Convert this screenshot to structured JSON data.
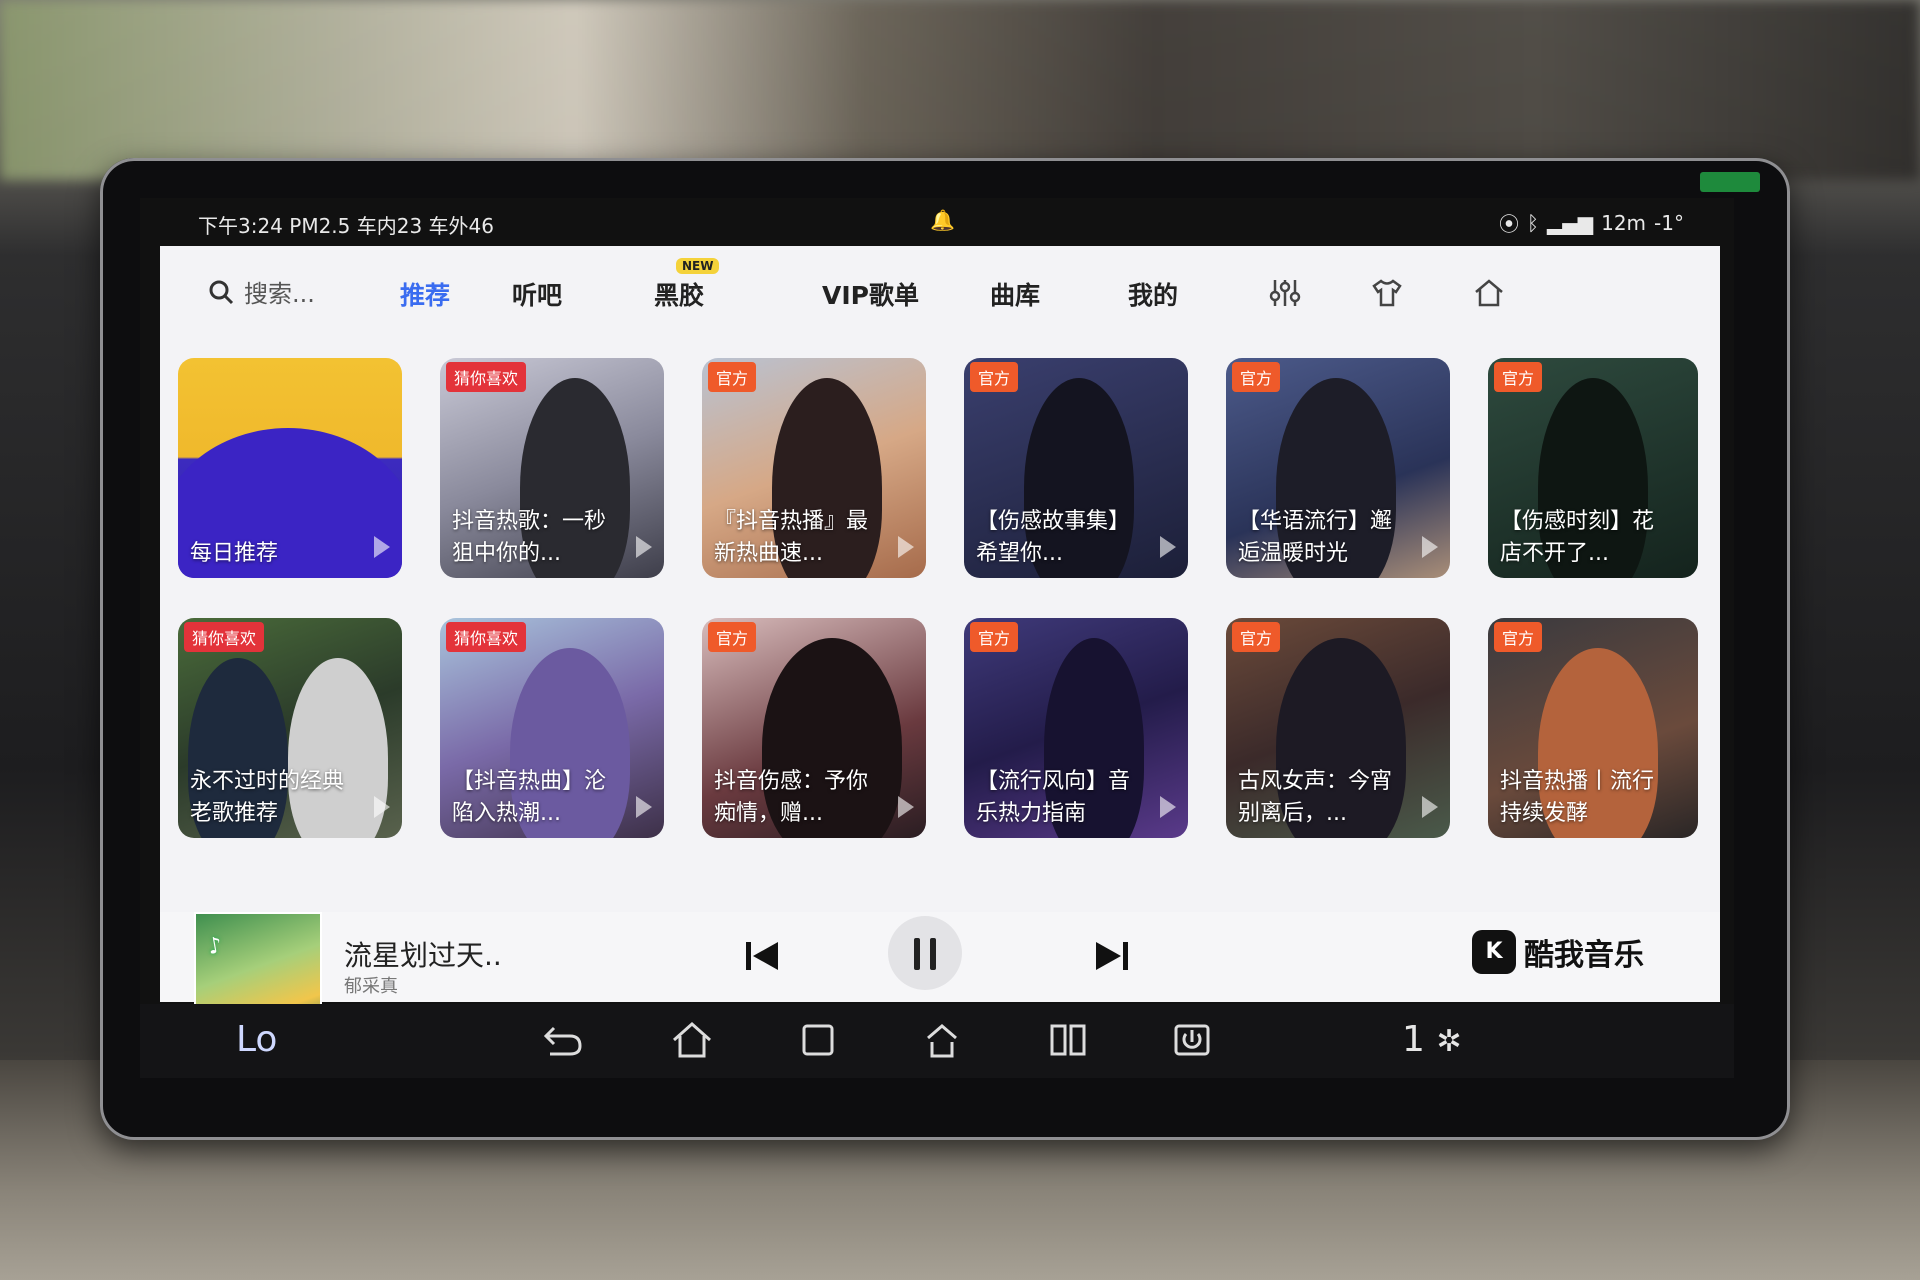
{
  "statusbar": {
    "left": "下午3:24 PM2.5 车内23 车外46",
    "center_icon": "bell-icon",
    "right": "12m",
    "temp": "-1°"
  },
  "nav": {
    "search_placeholder": "搜索...",
    "tabs": [
      {
        "label": "推荐",
        "active": true
      },
      {
        "label": "听吧"
      },
      {
        "label": "黑胶",
        "badge": "NEW"
      },
      {
        "label": "VIP歌单"
      },
      {
        "label": "曲库"
      },
      {
        "label": "我的"
      }
    ],
    "icons": [
      "equalizer-icon",
      "shirt-icon",
      "home-icon"
    ]
  },
  "cards": [
    {
      "title": "每日推荐",
      "tag": ""
    },
    {
      "title": "抖音热歌：一秒狙中你的...",
      "tag": "猜你喜欢"
    },
    {
      "title": "『抖音热播』最新热曲速...",
      "tag": "官方"
    },
    {
      "title": "【伤感故事集】希望你...",
      "tag": "官方"
    },
    {
      "title": "【华语流行】邂逅温暖时光",
      "tag": "官方"
    },
    {
      "title": "【伤感时刻】花店不开了...",
      "tag": "官方"
    },
    {
      "title": "永不过时的经典老歌推荐",
      "tag": "猜你喜欢"
    },
    {
      "title": "【抖音热曲】沦陷入热潮...",
      "tag": "猜你喜欢"
    },
    {
      "title": "抖音伤感：予你痴情，赠...",
      "tag": "官方"
    },
    {
      "title": "【流行风向】音乐热力指南",
      "tag": "官方"
    },
    {
      "title": "古风女声：今宵别离后，...",
      "tag": "官方"
    },
    {
      "title": "抖音热播丨流行持续发酵",
      "tag": "官方"
    }
  ],
  "player": {
    "song": "流星划过天..",
    "artist": "郁采真",
    "brand": "酷我音乐",
    "brand_logo": "K"
  },
  "dock": {
    "left": "Lo",
    "right": "1"
  },
  "colors": {
    "accent": "#3a6cf0",
    "tag_official": "#ef5a2a",
    "tag_like": "#e3333a"
  }
}
